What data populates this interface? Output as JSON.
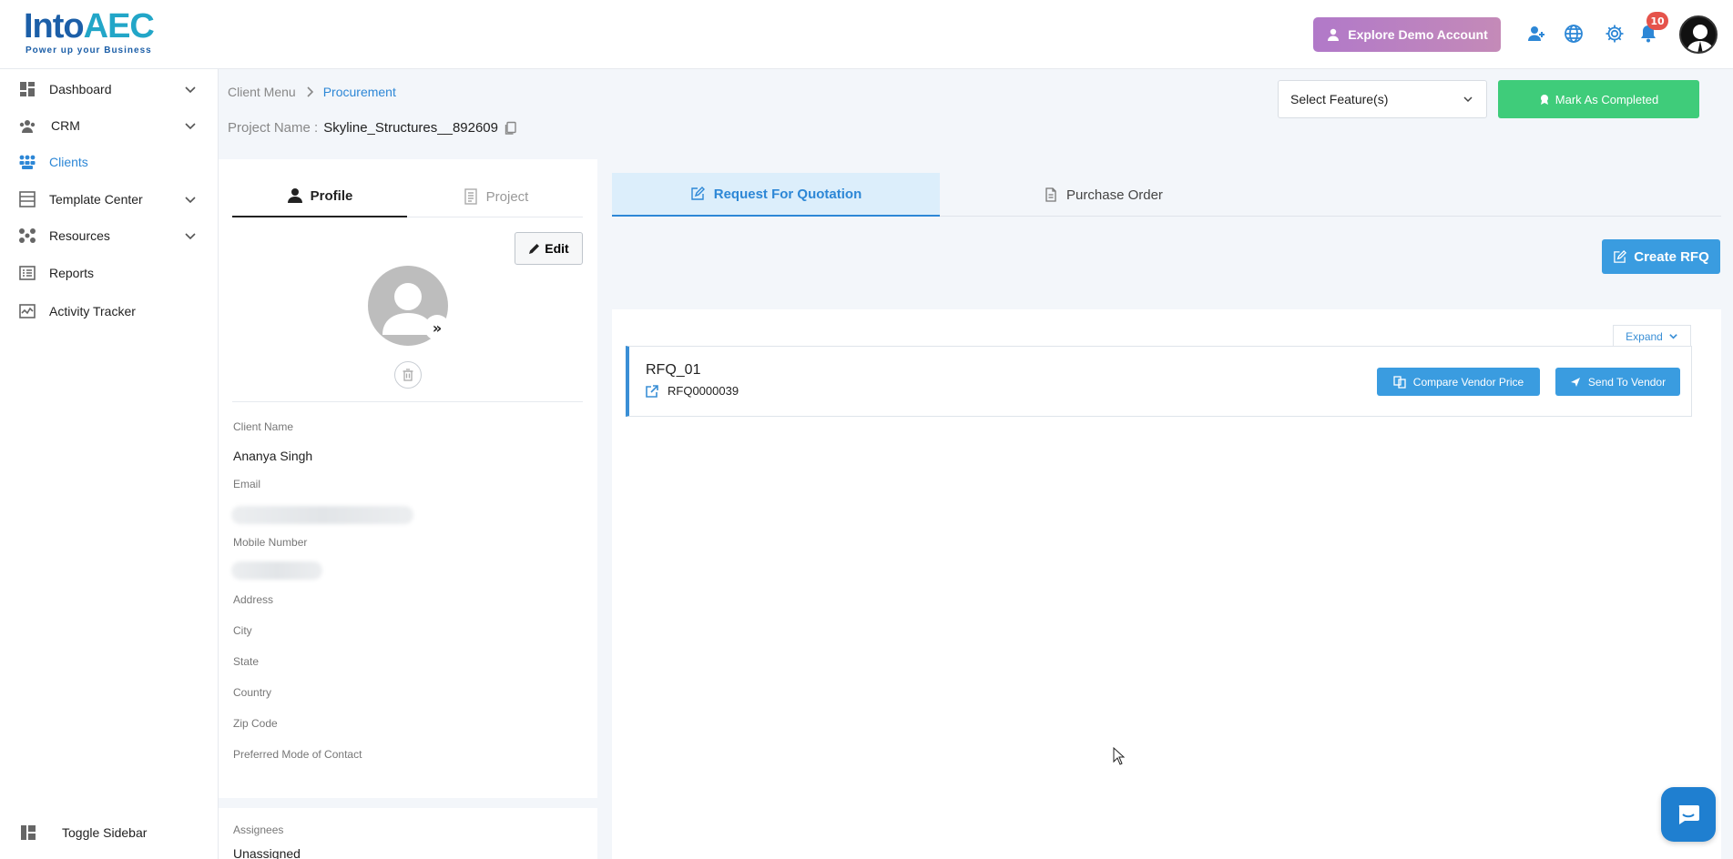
{
  "brand": {
    "logo_main": "Into",
    "logo_accent": "AEC",
    "tagline": "Power up your Business"
  },
  "topbar": {
    "demo_button": "Explore Demo Account",
    "notification_count": "10",
    "icons": [
      "add-user-icon",
      "globe-icon",
      "gear-icon",
      "bell-icon",
      "user-avatar"
    ]
  },
  "sidebar": {
    "items": [
      {
        "label": "Dashboard",
        "icon": "dashboard-icon",
        "expandable": true
      },
      {
        "label": "CRM",
        "icon": "crm-icon",
        "expandable": true
      },
      {
        "label": "Clients",
        "icon": "clients-icon",
        "expandable": false,
        "active": true
      },
      {
        "label": "Template Center",
        "icon": "template-icon",
        "expandable": true
      },
      {
        "label": "Resources",
        "icon": "resources-icon",
        "expandable": true
      },
      {
        "label": "Reports",
        "icon": "reports-icon",
        "expandable": false
      },
      {
        "label": "Activity Tracker",
        "icon": "activity-icon",
        "expandable": false
      }
    ],
    "toggle_label": "Toggle Sidebar"
  },
  "header": {
    "breadcrumb": [
      "Client Menu",
      "Procurement"
    ],
    "project_label": "Project Name :",
    "project_value": "Skyline_Structures__892609",
    "select_feature": "Select Feature(s)",
    "mark_completed": "Mark As Completed"
  },
  "profile": {
    "tabs": [
      "Profile",
      "Project"
    ],
    "edit_label": "Edit",
    "fields": {
      "client_name_label": "Client Name",
      "client_name_value": "Ananya Singh",
      "email_label": "Email",
      "mobile_label": "Mobile Number",
      "address_label": "Address",
      "city_label": "City",
      "state_label": "State",
      "country_label": "Country",
      "zip_label": "Zip Code",
      "preferred_label": "Preferred Mode of Contact"
    },
    "assignees_label": "Assignees",
    "assignees_value": "Unassigned"
  },
  "procurement": {
    "tabs": [
      "Request For Quotation",
      "Purchase Order"
    ],
    "create_rfq": "Create RFQ",
    "expand_label": "Expand",
    "rfq": {
      "title": "RFQ_01",
      "code": "RFQ0000039",
      "compare_label": "Compare Vendor Price",
      "send_label": "Send To Vendor"
    }
  },
  "colors": {
    "accent": "#2d87d6",
    "button_blue": "#3a9ce0",
    "success": "#3fcc7a",
    "badge": "#e5534b"
  }
}
